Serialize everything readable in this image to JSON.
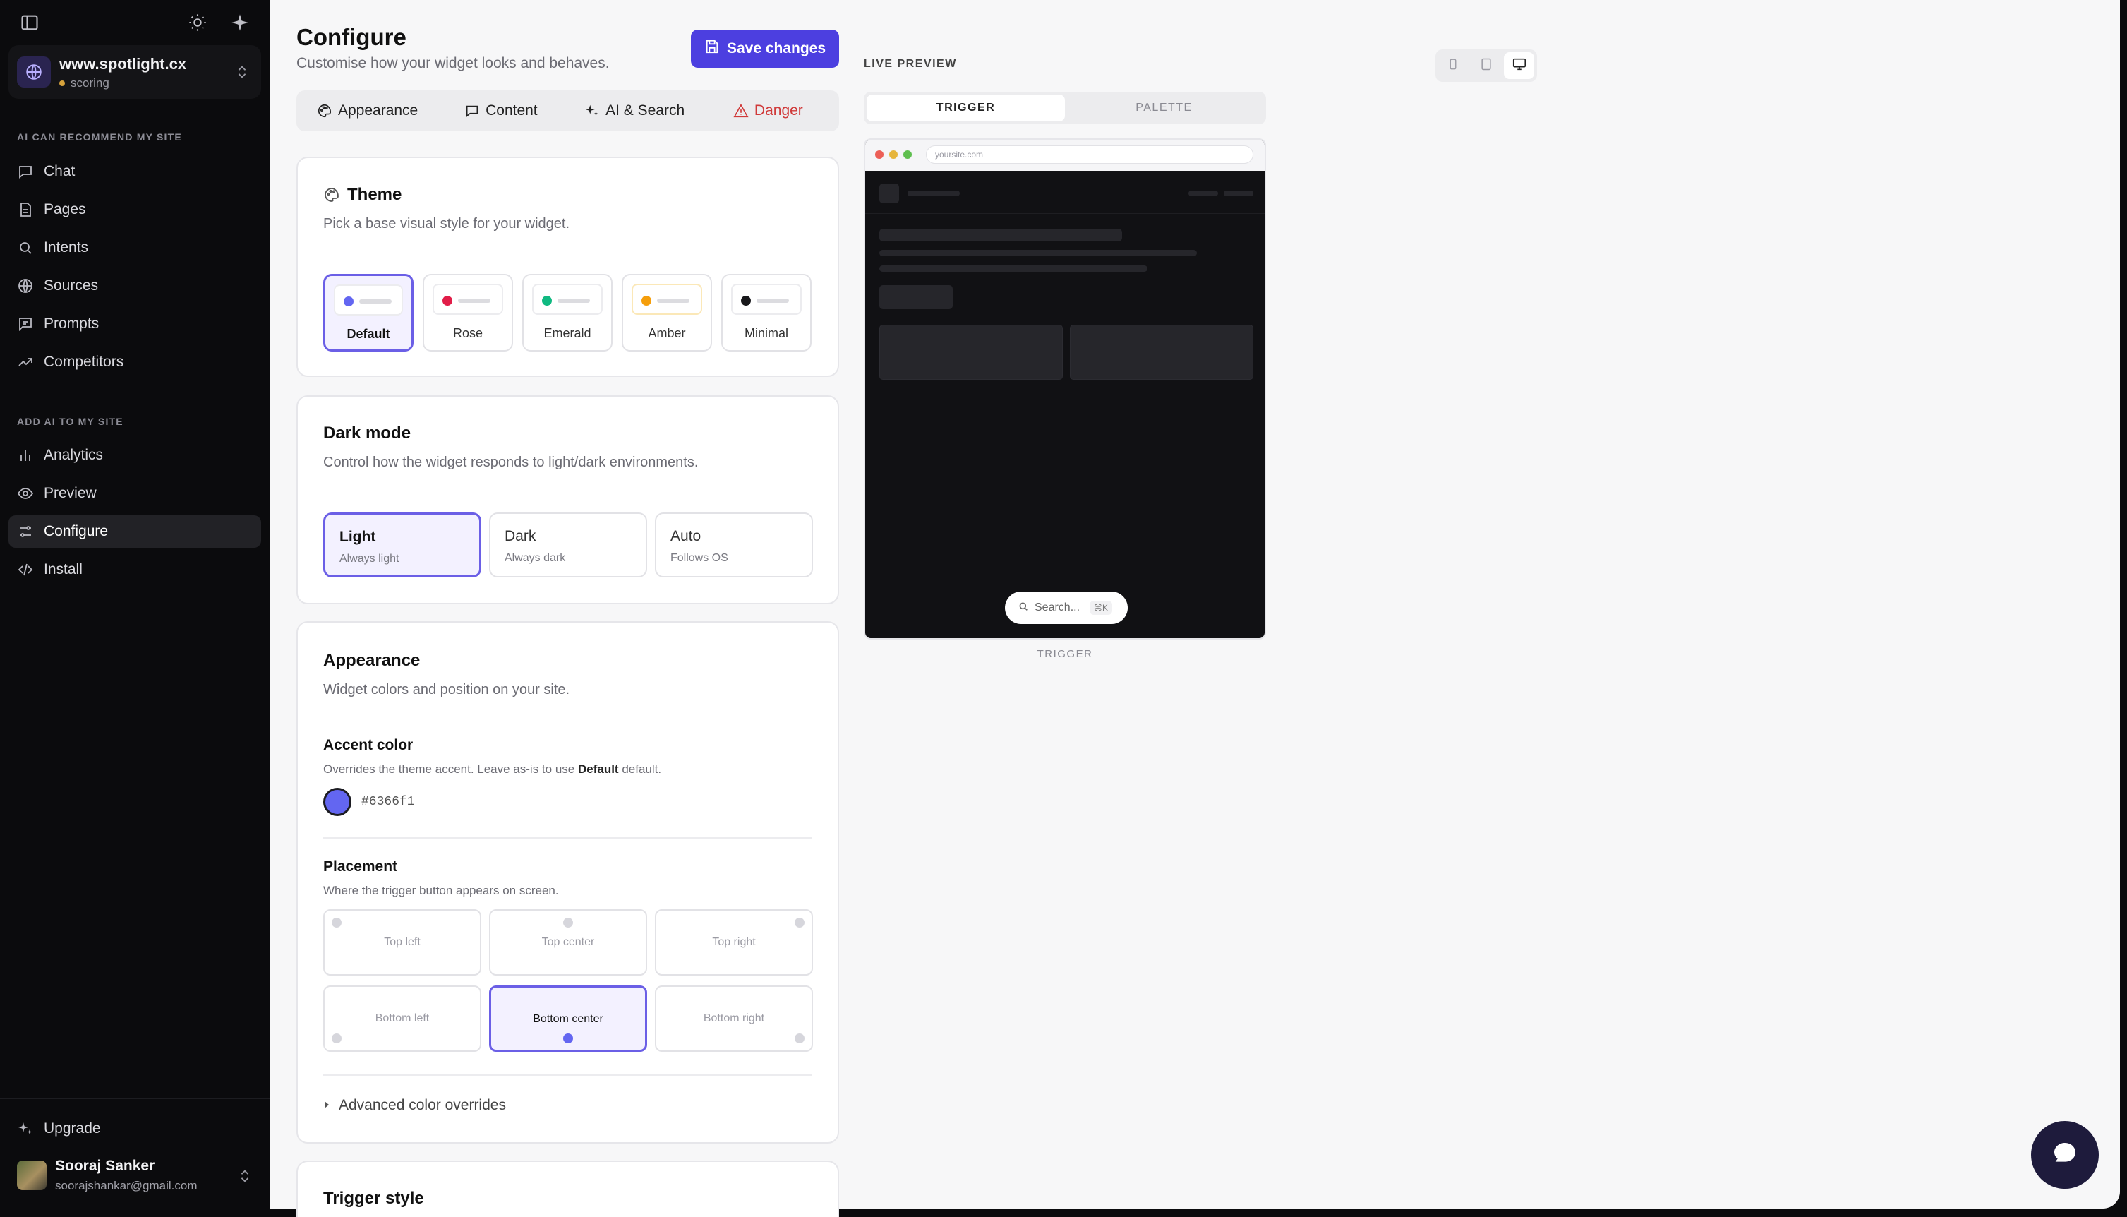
{
  "sidebar": {
    "site": {
      "name": "www.spotlight.cx",
      "status": "scoring"
    },
    "section_recommend": "AI CAN RECOMMEND MY SITE",
    "recommend_items": [
      {
        "label": "Chat",
        "icon": "chat-icon"
      },
      {
        "label": "Pages",
        "icon": "file-icon"
      },
      {
        "label": "Intents",
        "icon": "search-icon"
      },
      {
        "label": "Sources",
        "icon": "globe-icon"
      },
      {
        "label": "Prompts",
        "icon": "prompt-icon"
      },
      {
        "label": "Competitors",
        "icon": "trend-icon"
      }
    ],
    "section_add": "ADD AI TO MY SITE",
    "add_items": [
      {
        "label": "Analytics",
        "icon": "bar-chart-icon"
      },
      {
        "label": "Preview",
        "icon": "eye-icon"
      },
      {
        "label": "Configure",
        "icon": "sliders-icon",
        "active": true
      },
      {
        "label": "Install",
        "icon": "code-icon"
      }
    ],
    "upgrade_label": "Upgrade",
    "user": {
      "name": "Sooraj Sanker",
      "email": "soorajshankar@gmail.com"
    }
  },
  "header": {
    "title": "Configure",
    "subtitle": "Customise how your widget looks and behaves.",
    "save_label": "Save changes"
  },
  "tabs": [
    {
      "label": "Appearance",
      "icon": "palette-icon"
    },
    {
      "label": "Content",
      "icon": "message-icon"
    },
    {
      "label": "AI & Search",
      "icon": "sparkles-icon"
    },
    {
      "label": "Danger",
      "icon": "warning-icon"
    }
  ],
  "theme": {
    "title": "Theme",
    "desc": "Pick a base visual style for your widget.",
    "options": [
      {
        "label": "Default",
        "color": "#6366f1",
        "selected": true
      },
      {
        "label": "Rose",
        "color": "#e11d48"
      },
      {
        "label": "Emerald",
        "color": "#10b981"
      },
      {
        "label": "Amber",
        "color": "#f59e0b"
      },
      {
        "label": "Minimal",
        "color": "#18181b"
      }
    ]
  },
  "dark_mode": {
    "title": "Dark mode",
    "desc": "Control how the widget responds to light/dark environments.",
    "options": [
      {
        "name": "Light",
        "sub": "Always light",
        "selected": true
      },
      {
        "name": "Dark",
        "sub": "Always dark"
      },
      {
        "name": "Auto",
        "sub": "Follows OS"
      }
    ]
  },
  "appearance": {
    "title": "Appearance",
    "desc": "Widget colors and position on your site.",
    "accent_label": "Accent color",
    "accent_help_pre": "Overrides the theme accent. Leave as-is to use ",
    "accent_help_bold": "Default",
    "accent_help_post": " default.",
    "accent_hex": "#6366f1",
    "placement_label": "Placement",
    "placement_help": "Where the trigger button appears on screen.",
    "placements": [
      {
        "label": "Top left"
      },
      {
        "label": "Top center"
      },
      {
        "label": "Top right"
      },
      {
        "label": "Bottom left"
      },
      {
        "label": "Bottom center",
        "selected": true
      },
      {
        "label": "Bottom right"
      }
    ],
    "advanced_label": "Advanced color overrides"
  },
  "trigger_style": {
    "title": "Trigger style"
  },
  "preview": {
    "label": "LIVE PREVIEW",
    "tabs": [
      "TRIGGER",
      "PALETTE"
    ],
    "url": "yoursite.com",
    "search_placeholder": "Search...",
    "shortcut": "⌘K",
    "caption": "TRIGGER"
  }
}
